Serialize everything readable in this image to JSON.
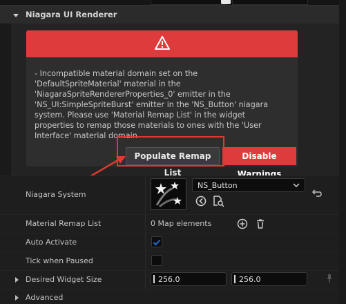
{
  "section": {
    "title": "Niagara UI Renderer"
  },
  "warning": {
    "message": "- Incompatible material domain set on the\n'DefaultSpriteMaterial' material in the\n'NiagaraSpriteRendererProperties_0' emitter in the\n'NS_UI:SimpleSpriteBurst' emitter in the 'NS_Button' niagara\nsystem. Please use 'Material Remap List' in the widget\nproperties to remap those materials to ones with the 'User\nInterface' material domain",
    "populate_label": "Populate Remap List",
    "disable_label": "Disable Warnings"
  },
  "properties": {
    "niagara_system": {
      "label": "Niagara System",
      "value": "NS_Button"
    },
    "material_remap": {
      "label": "Material Remap List",
      "value": "0 Map elements"
    },
    "auto_activate": {
      "label": "Auto Activate",
      "checked": true
    },
    "tick_when_paused": {
      "label": "Tick when Paused",
      "checked": false
    },
    "desired_widget_size": {
      "label": "Desired Widget Size",
      "x": "256.0",
      "y": "256.0"
    },
    "advanced": {
      "label": "Advanced"
    }
  },
  "colors": {
    "accent_red": "#de3c3c",
    "checkbox_blue": "#1f6fd8",
    "annotation": "#e03a2f"
  }
}
